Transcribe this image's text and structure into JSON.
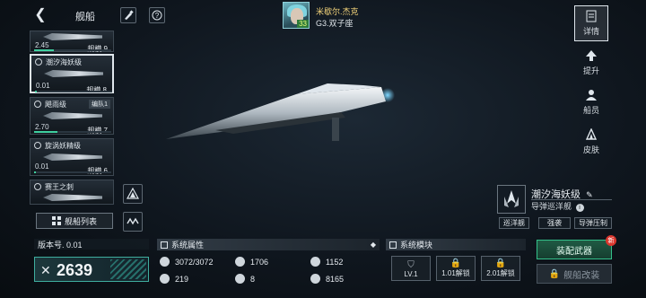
{
  "header": {
    "title": "舰船",
    "back_icon": "chevron-left-icon",
    "brush_icon": "brush-icon",
    "help_icon": "help-icon"
  },
  "commander": {
    "name": "米歇尔.杰克",
    "location": "G3.双子座",
    "level": "33"
  },
  "ship_list": [
    {
      "name": "",
      "power": "2.45",
      "scale": "规模.9",
      "selected": false,
      "bar": 0.25
    },
    {
      "name": "潮汐海妖级",
      "power": "0.01",
      "scale": "规模.8",
      "selected": true,
      "bar": 0.02
    },
    {
      "name": "飓雨级",
      "power": "2.70",
      "scale": "规模.7",
      "selected": false,
      "tag": "编队1",
      "bar": 0.3
    },
    {
      "name": "旋涡妖精级",
      "power": "0.01",
      "scale": "规模.6",
      "selected": false,
      "bar": 0.02
    },
    {
      "name": "赛王之刺",
      "power": "",
      "scale": "",
      "selected": false,
      "bar": 0
    }
  ],
  "list_actions": {
    "fleet_list": "舰船列表"
  },
  "right_tabs": [
    {
      "label": "详情",
      "icon": "document-icon",
      "active": true
    },
    {
      "label": "提升",
      "icon": "upgrade-icon",
      "active": false
    },
    {
      "label": "船员",
      "icon": "crew-icon",
      "active": false
    },
    {
      "label": "皮肤",
      "icon": "skin-icon",
      "active": false
    }
  ],
  "ship_info": {
    "name": "潮汐海妖级",
    "type": "导弹巡洋舰",
    "chips": [
      "巡洋舰",
      "强袭",
      "导弹压制"
    ]
  },
  "bottom": {
    "version": "版本号. 0.01",
    "power": "2639",
    "attributes_title": "系统属性",
    "stats": [
      {
        "icon": "armor-icon",
        "value": "3072/3072"
      },
      {
        "icon": "shield-icon",
        "value": "1706"
      },
      {
        "icon": "target-icon",
        "value": "1152"
      },
      {
        "icon": "speed-icon",
        "value": "219"
      },
      {
        "icon": "grid-icon",
        "value": "8"
      },
      {
        "icon": "fire-icon",
        "value": "8165"
      }
    ],
    "modules_title": "系统模块",
    "modules": [
      {
        "label": "LV.1",
        "locked": false
      },
      {
        "label": "1.01解锁",
        "locked": true
      },
      {
        "label": "2.01解锁",
        "locked": true
      }
    ],
    "equip_label": "装配武器",
    "new_badge": "新",
    "refit_label": "舰船改装"
  },
  "colors": {
    "accent": "#34c08a",
    "gold": "#f2d37a",
    "badge": "#d9362d"
  }
}
